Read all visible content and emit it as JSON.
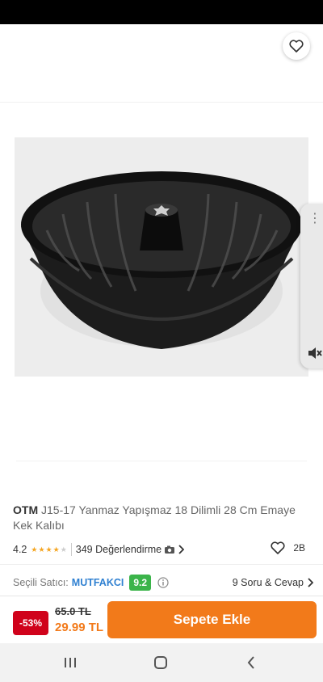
{
  "product": {
    "brand": "OTM",
    "title": "J15-17 Yanmaz Yapışmaz 18 Dilimli 28 Cm Emaye Kek Kalıbı",
    "rating": "4.2",
    "rating_stars": 4,
    "review_text": "349 Değerlendirme",
    "like_count": "2B"
  },
  "seller": {
    "label": "Seçili Satıcı:",
    "name": "MUTFAKCI",
    "score": "9.2",
    "qa_label": "9 Soru & Cevap"
  },
  "purchase": {
    "discount": "-53%",
    "old_price": "65.0 TL",
    "new_price": "29.99 TL",
    "add_to_cart": "Sepete Ekle"
  },
  "colors": {
    "accent": "#f27a1a",
    "discount_red": "#d0021b",
    "seller_green": "#3bb44a",
    "seller_blue": "#2f80d1"
  },
  "icons": [
    "back-arrow-icon",
    "share-icon",
    "heart-icon",
    "more-dots-icon",
    "mute-icon",
    "star-icon",
    "camera-icon",
    "chevron-right-icon",
    "info-icon",
    "recent-apps-icon",
    "home-icon",
    "back-nav-icon"
  ]
}
